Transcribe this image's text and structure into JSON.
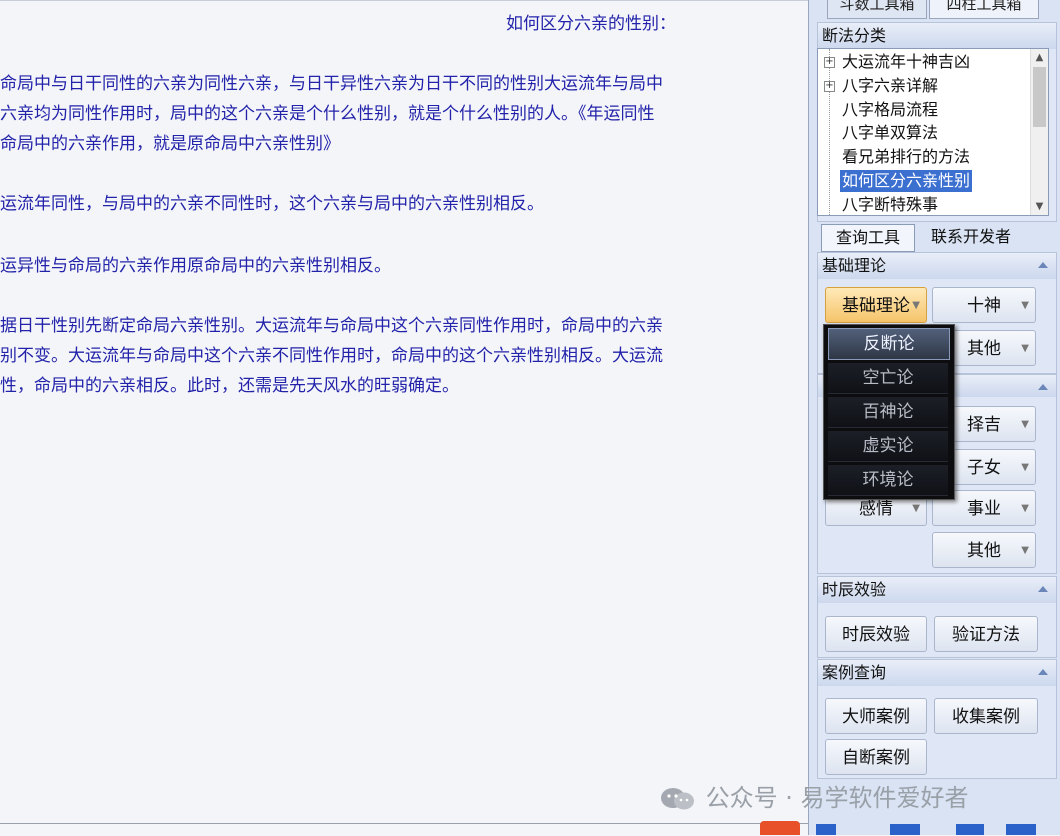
{
  "content": {
    "title": "如何区分六亲的性别：",
    "lines": [
      "命局中与日干同性的六亲为同性六亲，与日干异性六亲为日干不同的性别大运流年与局中",
      "六亲均为同性作用时，局中的这个六亲是个什么性别，就是个什么性别的人。《年运同性",
      "命局中的六亲作用，就是原命局中六亲性别》",
      "运流年同性，与局中的六亲不同性时，这个六亲与局中的六亲性别相反。",
      "运异性与命局的六亲作用原命局中的六亲性别相反。",
      "据日干性别先断定命局六亲性别。大运流年与命局中这个六亲同性作用时，命局中的六亲",
      "别不变。大运流年与命局中这个六亲不同性作用时，命局中的这个六亲性别相反。大运流",
      "性，命局中的六亲相反。此时，还需是先天风水的旺弱确定。"
    ]
  },
  "top_tabs": [
    "斗数工具箱",
    "四柱工具箱"
  ],
  "duanfa": {
    "header": "断法分类",
    "items": [
      {
        "label": "大运流年十神吉凶",
        "expandable": true
      },
      {
        "label": "八字六亲详解",
        "expandable": true
      },
      {
        "label": "八字格局流程",
        "expandable": false
      },
      {
        "label": "八字单双算法",
        "expandable": false
      },
      {
        "label": "看兄弟排行的方法",
        "expandable": false
      },
      {
        "label": "如何区分六亲性别",
        "expandable": false,
        "selected": true
      },
      {
        "label": "八字断特殊事",
        "expandable": false
      }
    ]
  },
  "tabs2": [
    "查询工具",
    "联系开发者"
  ],
  "jichu": {
    "header": "基础理论",
    "buttons": [
      "基础理论",
      "十神",
      "其他"
    ]
  },
  "section2": {
    "buttons": [
      "择吉",
      "子女",
      "感情",
      "事业",
      "其他"
    ]
  },
  "dropdown": {
    "items": [
      "反断论",
      "空亡论",
      "百神论",
      "虚实论",
      "环境论"
    ],
    "highlighted_index": 0
  },
  "shichen": {
    "header": "时辰效验",
    "buttons": [
      "时辰效验",
      "验证方法"
    ]
  },
  "anli": {
    "header": "案例查询",
    "buttons": [
      "大师案例",
      "收集案例",
      "自断案例"
    ]
  },
  "watermark": "公众号 · 易学软件爱好者",
  "colors": {
    "text_blue": "#2222aa",
    "panel_bg": "#d9e3f4",
    "highlight_orange": "#f5c46a",
    "tree_selection": "#3b6fd0",
    "dropdown_bg": "#0d0d10"
  }
}
